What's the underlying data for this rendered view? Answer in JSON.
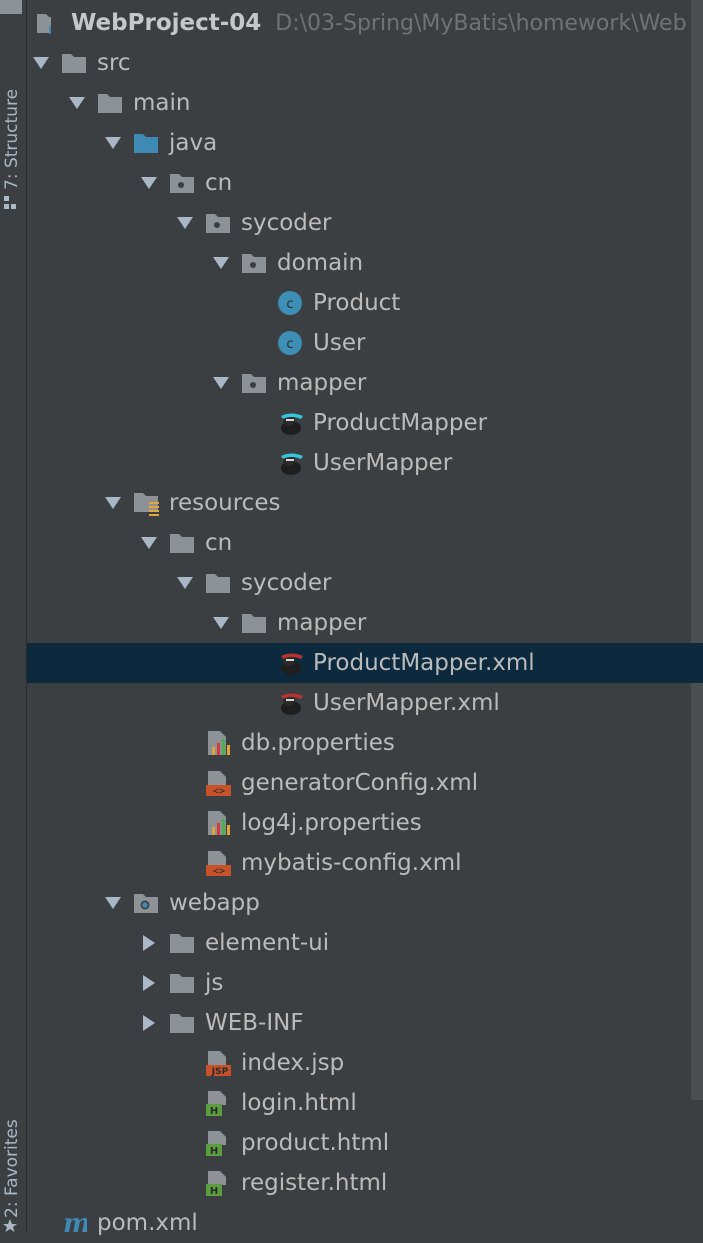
{
  "sidebar": {
    "structure_tab": "7: Structure",
    "favorites_tab": "2: Favorites"
  },
  "project": {
    "name": "WebProject-04",
    "path": "D:\\03-Spring\\MyBatis\\homework\\Web"
  },
  "tree": [
    {
      "label": "src",
      "icon": "folder-icon",
      "expanded": true
    },
    {
      "label": "main",
      "icon": "folder-icon",
      "expanded": true
    },
    {
      "label": "java",
      "icon": "source-folder-icon",
      "expanded": true
    },
    {
      "label": "cn",
      "icon": "package-icon",
      "expanded": true
    },
    {
      "label": "sycoder",
      "icon": "package-icon",
      "expanded": true
    },
    {
      "label": "domain",
      "icon": "package-icon",
      "expanded": true
    },
    {
      "label": "Product",
      "icon": "class-icon"
    },
    {
      "label": "User",
      "icon": "class-icon"
    },
    {
      "label": "mapper",
      "icon": "package-icon",
      "expanded": true
    },
    {
      "label": "ProductMapper",
      "icon": "mybatis-interface-icon"
    },
    {
      "label": "UserMapper",
      "icon": "mybatis-interface-icon"
    },
    {
      "label": "resources",
      "icon": "resources-folder-icon",
      "expanded": true
    },
    {
      "label": "cn",
      "icon": "folder-icon",
      "expanded": true
    },
    {
      "label": "sycoder",
      "icon": "folder-icon",
      "expanded": true
    },
    {
      "label": "mapper",
      "icon": "folder-icon",
      "expanded": true
    },
    {
      "label": "ProductMapper.xml",
      "icon": "mybatis-xml-icon",
      "selected": true
    },
    {
      "label": "UserMapper.xml",
      "icon": "mybatis-xml-icon"
    },
    {
      "label": "db.properties",
      "icon": "properties-file-icon"
    },
    {
      "label": "generatorConfig.xml",
      "icon": "xml-file-icon"
    },
    {
      "label": "log4j.properties",
      "icon": "properties-file-icon"
    },
    {
      "label": "mybatis-config.xml",
      "icon": "xml-file-icon"
    },
    {
      "label": "webapp",
      "icon": "web-folder-icon",
      "expanded": true
    },
    {
      "label": "element-ui",
      "icon": "folder-icon",
      "expanded": false
    },
    {
      "label": "js",
      "icon": "folder-icon",
      "expanded": false
    },
    {
      "label": "WEB-INF",
      "icon": "folder-icon",
      "expanded": false
    },
    {
      "label": "index.jsp",
      "icon": "jsp-file-icon"
    },
    {
      "label": "login.html",
      "icon": "html-file-icon"
    },
    {
      "label": "product.html",
      "icon": "html-file-icon"
    },
    {
      "label": "register.html",
      "icon": "html-file-icon"
    },
    {
      "label": "pom.xml",
      "icon": "maven-icon"
    }
  ],
  "colors": {
    "background": "#3c3f41",
    "selection": "#0d293e",
    "folder": "#8d9296",
    "source_folder": "#3f8ab5",
    "class_badge": "#3d8fb5"
  }
}
